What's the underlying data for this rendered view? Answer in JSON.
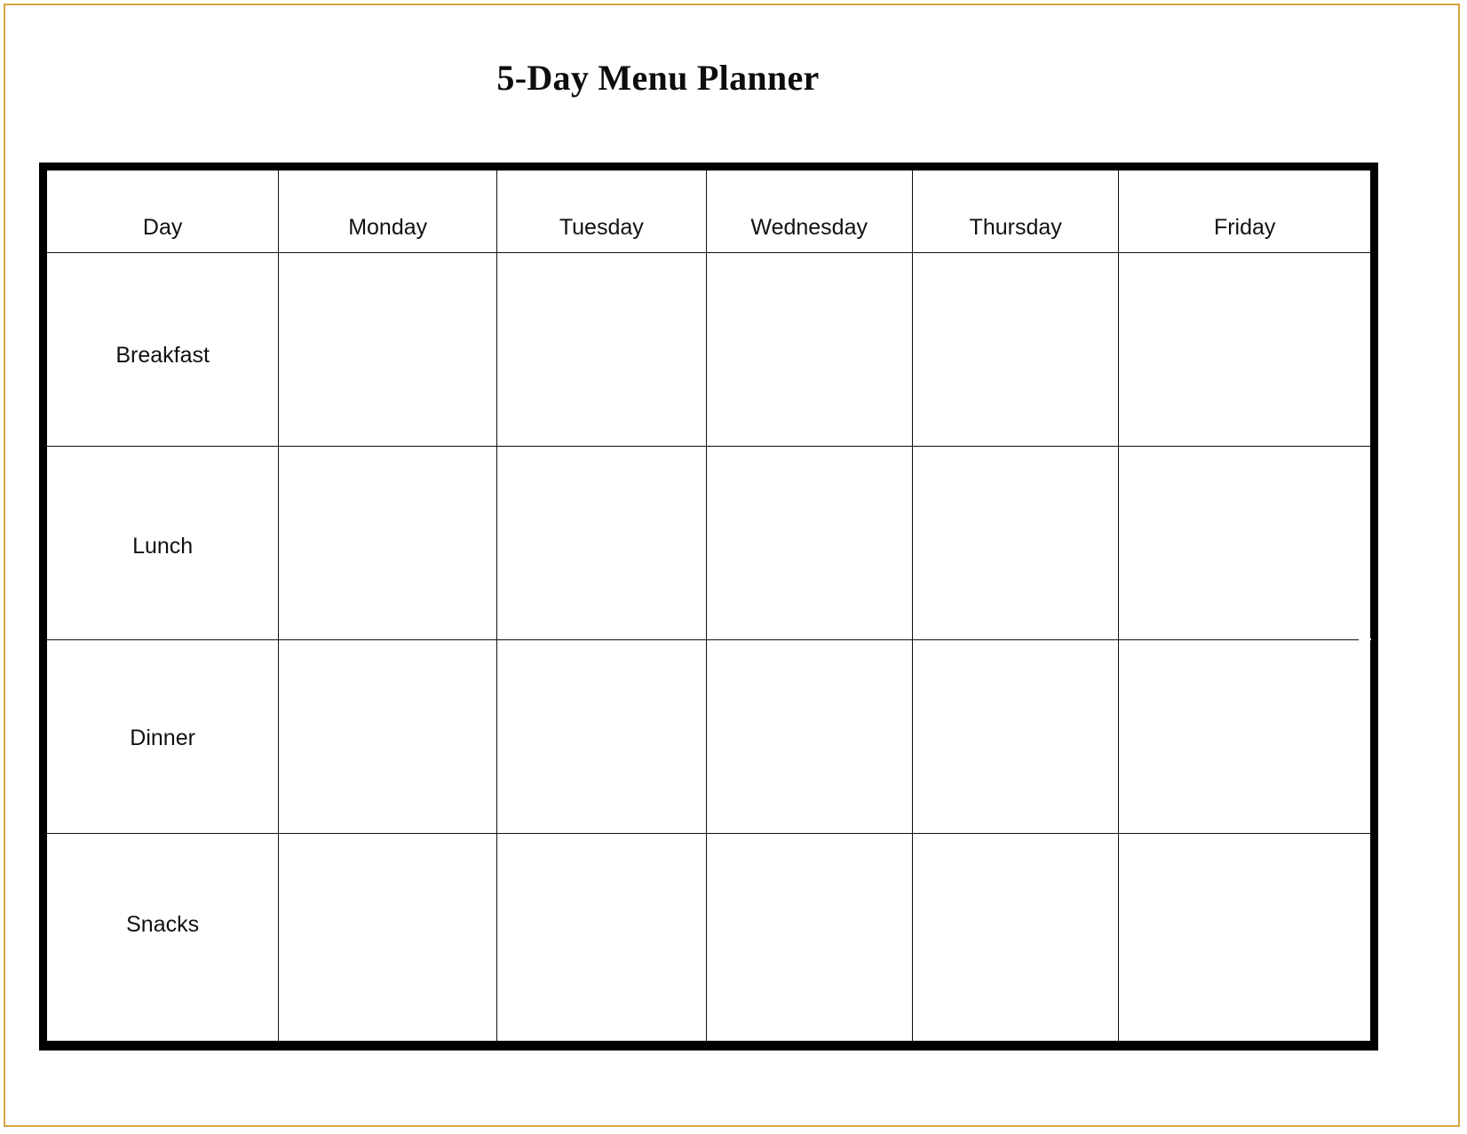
{
  "document": {
    "title": "5-Day Menu Planner",
    "frame_color": "#d9a441",
    "table_border_color": "#000000",
    "grid_line_color": "#111111",
    "background_color": "#ffffff"
  },
  "table": {
    "headers": [
      {
        "key": "day",
        "label": "Day"
      },
      {
        "key": "monday",
        "label": "Monday"
      },
      {
        "key": "tuesday",
        "label": "Tuesday"
      },
      {
        "key": "wednesday",
        "label": "Wednesday"
      },
      {
        "key": "thursday",
        "label": "Thursday"
      },
      {
        "key": "friday",
        "label": "Friday"
      }
    ],
    "rows": [
      {
        "label": "Breakfast",
        "cells": {
          "monday": "",
          "tuesday": "",
          "wednesday": "",
          "thursday": "",
          "friday": ""
        }
      },
      {
        "label": "Lunch",
        "cells": {
          "monday": "",
          "tuesday": "",
          "wednesday": "",
          "thursday": "",
          "friday": ""
        }
      },
      {
        "label": "Dinner",
        "cells": {
          "monday": "",
          "tuesday": "",
          "wednesday": "",
          "thursday": "",
          "friday": ""
        }
      },
      {
        "label": "Snacks",
        "cells": {
          "monday": "",
          "tuesday": "",
          "wednesday": "",
          "thursday": "",
          "friday": ""
        }
      }
    ]
  }
}
